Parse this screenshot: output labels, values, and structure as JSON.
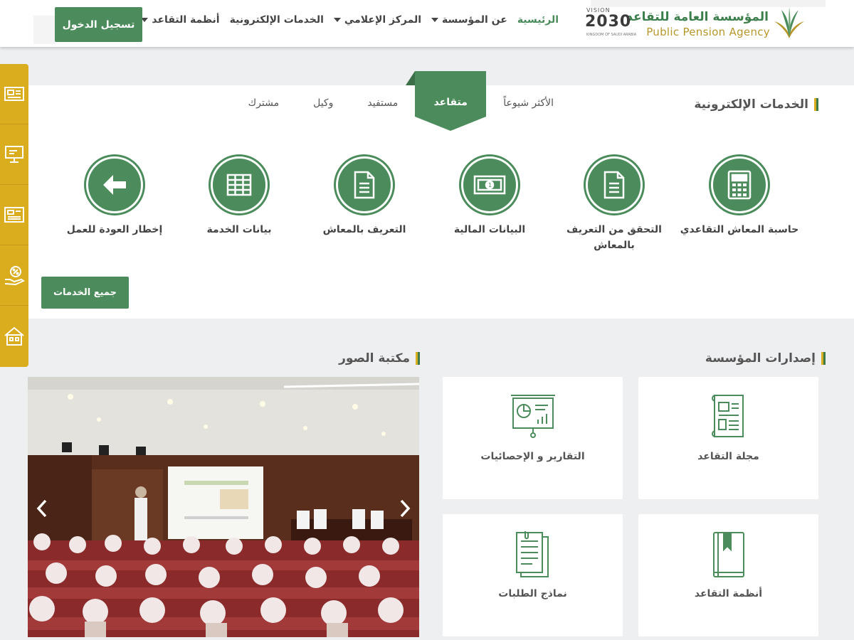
{
  "header": {
    "logo_ar": "المؤسسة العامة للتقاعد",
    "logo_en": "Public Pension Agency",
    "vision_label": "VISION",
    "vision_year": "2030",
    "vision_sub": "KINGDOM OF SAUDI ARABIA",
    "nav": [
      {
        "label": "الرئيسية",
        "active": true,
        "dropdown": false
      },
      {
        "label": "عن المؤسسة",
        "active": false,
        "dropdown": true
      },
      {
        "label": "المركز الإعلامي",
        "active": false,
        "dropdown": true
      },
      {
        "label": "الخدمات الإلكترونية",
        "active": false,
        "dropdown": false
      },
      {
        "label": "أنظمة التقاعد",
        "active": false,
        "dropdown": true
      }
    ],
    "login_label": "تسجيل الدخول"
  },
  "side_tools": [
    "newspaper-icon",
    "monitor-icon",
    "document-icon",
    "percent-hand-icon",
    "house-icon"
  ],
  "eservices": {
    "title": "الخدمات الإلكترونية",
    "tabs": [
      {
        "label": "الأكثر شيوعاً",
        "active": false
      },
      {
        "label": "متقاعد",
        "active": true
      },
      {
        "label": "مستفيد",
        "active": false
      },
      {
        "label": "وكيل",
        "active": false
      },
      {
        "label": "مشترك",
        "active": false
      }
    ],
    "items": [
      {
        "label": "حاسبة المعاش التقاعدي",
        "icon": "calculator-icon"
      },
      {
        "label": "التحقق من التعريف بالمعاش",
        "icon": "document-check-icon"
      },
      {
        "label": "البيانات المالية",
        "icon": "money-icon"
      },
      {
        "label": "التعريف بالمعاش",
        "icon": "document-icon"
      },
      {
        "label": "بيانات الخدمة",
        "icon": "table-icon"
      },
      {
        "label": "إخطار العودة للعمل",
        "icon": "arrow-left-icon"
      }
    ],
    "all_label": "جميع الخدمات"
  },
  "publications": {
    "title": "إصدارات المؤسسة",
    "items": [
      {
        "label": "مجلة التقاعد",
        "icon": "magazine-icon"
      },
      {
        "label": "التقارير و الإحصائيات",
        "icon": "presentation-chart-icon"
      },
      {
        "label": "أنظمة التقاعد",
        "icon": "book-icon"
      },
      {
        "label": "نماذج الطلبات",
        "icon": "forms-icon"
      }
    ]
  },
  "gallery": {
    "title": "مكتبة الصور"
  },
  "colors": {
    "primary": "#4c8c5c",
    "gold": "#d9ad1d",
    "dark_green": "#3f7a4b"
  }
}
